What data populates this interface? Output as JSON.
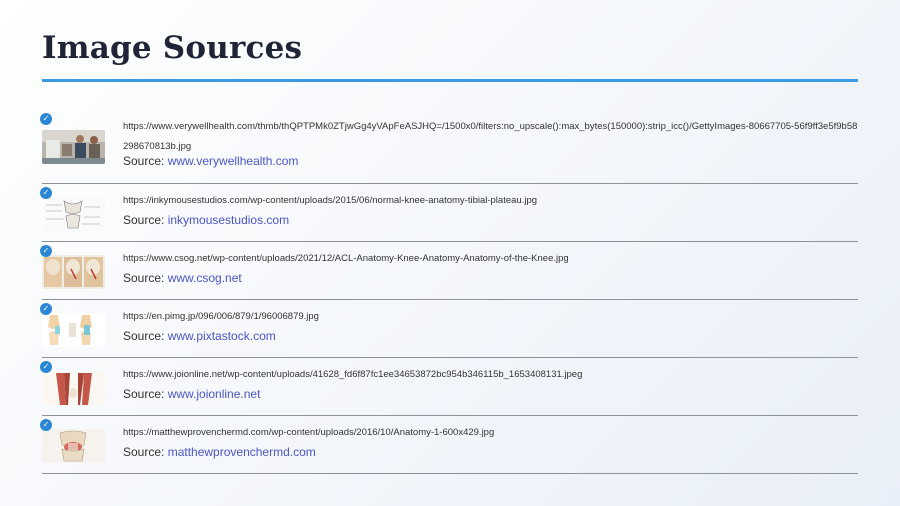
{
  "page": {
    "title": "Image Sources"
  },
  "sources": [
    {
      "url": "https://www.verywellhealth.com/thmb/thQPTPMk0ZTjwGg4yVApFeASJHQ=/1500x0/filters:no_upscale():max_bytes(150000):strip_icc()/GettyImages-80667705-56f9ff3e5f9b58298670813b.jpg",
      "source_label": "Source:",
      "domain": "www.verywellhealth.com"
    },
    {
      "url": "https://inkymousestudios.com/wp-content/uploads/2015/06/normal-knee-anatomy-tibial-plateau.jpg",
      "source_label": "Source:",
      "domain": "inkymousestudios.com"
    },
    {
      "url": "https://www.csog.net/wp-content/uploads/2021/12/ACL-Anatomy-Knee-Anatomy-Anatomy-of-the-Knee.jpg",
      "source_label": "Source:",
      "domain": "www.csog.net"
    },
    {
      "url": "https://en.pimg.jp/096/006/879/1/96006879.jpg",
      "source_label": "Source:",
      "domain": "www.pixtastock.com"
    },
    {
      "url": "https://www.joionline.net/wp-content/uploads/41628_fd6f87fc1ee34653872bc954b346115b_1653408131.jpeg",
      "source_label": "Source:",
      "domain": "www.joionline.net"
    },
    {
      "url": "https://matthewprovenchermd.com/wp-content/uploads/2016/10/Anatomy-1-600x429.jpg",
      "source_label": "Source:",
      "domain": "matthewprovenchermd.com"
    }
  ],
  "icons": {
    "check": "check-circle-icon"
  },
  "colors": {
    "accent": "#3a9be0",
    "link": "#4a55c8",
    "check": "#2a87d6"
  }
}
